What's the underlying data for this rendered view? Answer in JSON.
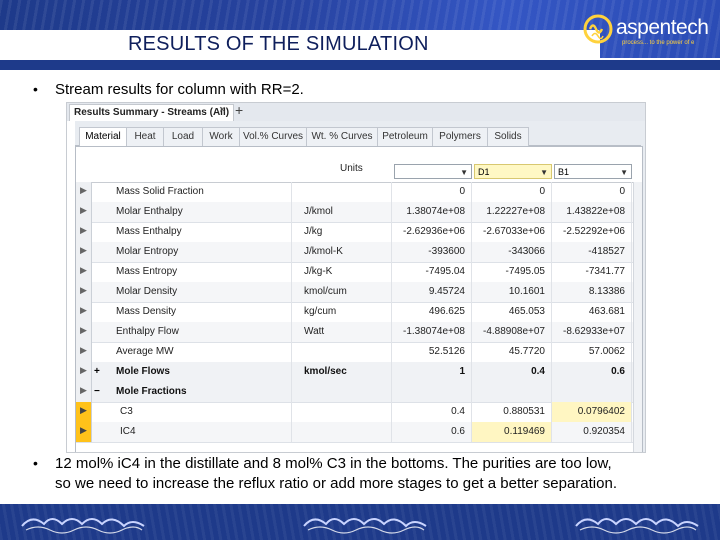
{
  "slide": {
    "title": "RESULTS OF THE SIMULATION",
    "logo_text": "aspentech",
    "logo_tagline": "process... to the power of e",
    "bullet1": "Stream results for column with RR=2.",
    "bullet2_line1": "12 mol% iC4 in the distillate and 8 mol% C3 in the bottoms. The purities are too low,",
    "bullet2_line2": "so we need to increase the reflux ratio or add more stages to get a better separation.",
    "bullet_symbol": "•"
  },
  "window": {
    "doc_tab": "Results Summary - Streams (All)",
    "doc_tab_close": "×",
    "doc_tab_add": "+",
    "subtabs": [
      "Material",
      "Heat",
      "Load",
      "Work",
      "Vol.% Curves",
      "Wt. % Curves",
      "Petroleum",
      "Polymers",
      "Solids"
    ],
    "active_subtab": "Material"
  },
  "grid": {
    "units_header": "Units",
    "streams": [
      "",
      "D1",
      "B1"
    ],
    "rows": [
      {
        "prop": "Mass Solid Fraction",
        "unit": "",
        "v1": "0",
        "v2": "0",
        "v3": "0"
      },
      {
        "prop": "Molar Enthalpy",
        "unit": "J/kmol",
        "v1": "1.38074e+08",
        "v2": "1.22227e+08",
        "v3": "1.43822e+08"
      },
      {
        "prop": "Mass Enthalpy",
        "unit": "J/kg",
        "v1": "-2.62936e+06",
        "v2": "-2.67033e+06",
        "v3": "-2.52292e+06"
      },
      {
        "prop": "Molar Entropy",
        "unit": "J/kmol-K",
        "v1": "-393600",
        "v2": "-343066",
        "v3": "-418527"
      },
      {
        "prop": "Mass Entropy",
        "unit": "J/kg-K",
        "v1": "-7495.04",
        "v2": "-7495.05",
        "v3": "-7341.77"
      },
      {
        "prop": "Molar Density",
        "unit": "kmol/cum",
        "v1": "9.45724",
        "v2": "10.1601",
        "v3": "8.13386"
      },
      {
        "prop": "Mass Density",
        "unit": "kg/cum",
        "v1": "496.625",
        "v2": "465.053",
        "v3": "463.681"
      },
      {
        "prop": "Enthalpy Flow",
        "unit": "Watt",
        "v1": "-1.38074e+08",
        "v2": "-4.88908e+07",
        "v3": "-8.62933e+07"
      },
      {
        "prop": "Average MW",
        "unit": "",
        "v1": "52.5126",
        "v2": "45.7720",
        "v3": "57.0062"
      }
    ],
    "mole_flows": {
      "expander": "+",
      "prop": "Mole Flows",
      "unit": "kmol/sec",
      "v1": "1",
      "v2": "0.4",
      "v3": "0.6"
    },
    "mole_fractions": {
      "expander": "−",
      "prop": "Mole Fractions"
    },
    "components": [
      {
        "prop": "C3",
        "v1": "0.4",
        "v2": "0.880531",
        "v3": "0.0796402"
      },
      {
        "prop": "IC4",
        "v1": "0.6",
        "v2": "0.119469",
        "v3": "0.920354"
      }
    ]
  },
  "colors": {
    "header_blue": "#1e3a8a",
    "title_navy": "#0f1f5c",
    "logo_yellow": "#ffd23c",
    "selection_orange": "#ffc21a",
    "highlight_yellow": "#fff6c2"
  }
}
